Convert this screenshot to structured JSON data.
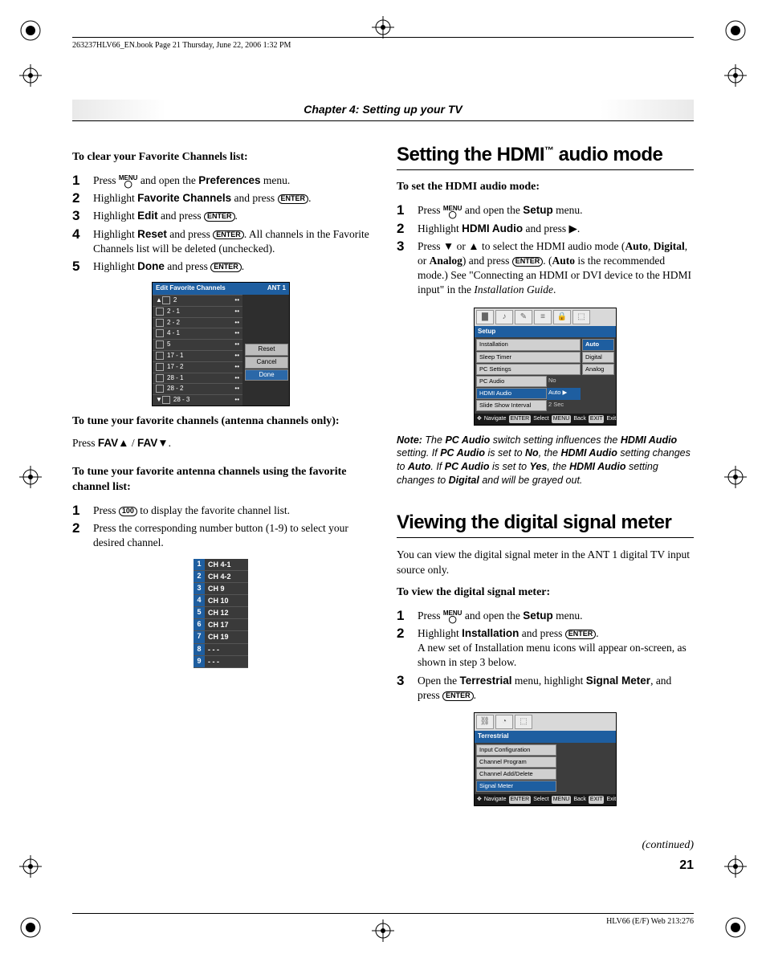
{
  "header": {
    "info": "263237HLV66_EN.book  Page 21  Thursday, June 22, 2006  1:32 PM"
  },
  "chapter": "Chapter 4: Setting up your TV",
  "left": {
    "h1": "To clear your Favorite Channels list:",
    "s1": {
      "a": "Press ",
      "b": " and open the ",
      "c": "Preferences",
      "d": " menu."
    },
    "s2": {
      "a": "Highlight ",
      "b": "Favorite Channels",
      "c": " and press "
    },
    "s3": {
      "a": "Highlight ",
      "b": "Edit",
      "c": " and press "
    },
    "s4": {
      "a": "Highlight ",
      "b": "Reset",
      "c": " and press ",
      "d": ". All channels in the Favorite Channels list will be deleted (unchecked)."
    },
    "s5": {
      "a": "Highlight ",
      "b": "Done",
      "c": " and press "
    },
    "osd1": {
      "title": "Edit Favorite Channels",
      "ant": "ANT 1",
      "rows": [
        "2",
        "2 - 1",
        "2 - 2",
        "4 - 1",
        "5",
        "17 - 1",
        "17 - 2",
        "28 - 1",
        "28 - 2",
        "28 - 3"
      ],
      "btns": [
        "Reset",
        "Cancel",
        "Done"
      ]
    },
    "h2": "To tune your favorite channels (antenna channels only):",
    "p2": {
      "a": "Press ",
      "b": "FAV▲",
      "c": " / ",
      "d": "FAV▼",
      "e": "."
    },
    "h3": "To tune your favorite antenna channels using the favorite channel list:",
    "s6": "Press  to display the favorite channel list.",
    "s6a": "Press ",
    "s6b": " to display the favorite channel list.",
    "s7": "Press the corresponding number button (1-9) to select your desired channel.",
    "favlist": [
      "CH 4-1",
      "CH 4-2",
      "CH 9",
      "CH 10",
      "CH 12",
      "CH 17",
      "CH 19",
      "- - -",
      "- - -"
    ]
  },
  "right": {
    "title1": "Setting the HDMI™ audio mode",
    "h1": "To set the HDMI audio mode:",
    "s1": {
      "a": "Press ",
      "b": " and open the ",
      "c": "Setup",
      "d": " menu."
    },
    "s2": {
      "a": "Highlight ",
      "b": "HDMI Audio",
      "c": " and press ▶."
    },
    "s3": {
      "a": "Press ▼ or ▲ to select the HDMI audio mode (",
      "b": "Auto",
      "c": ", ",
      "d": "Digital",
      "e": ", or ",
      "f": "Analog",
      "g": ") and press ",
      "h": ". (",
      "i": "Auto",
      "j": " is the recommended mode.) See \"Connecting an HDMI or DVI device to the HDMI input\" in the ",
      "k": "Installation Guide",
      "l": "."
    },
    "osd2": {
      "hdr": "Setup",
      "items": [
        "Installation",
        "Sleep Timer",
        "PC Settings",
        "PC Audio",
        "HDMI Audio",
        "Slide Show Interval"
      ],
      "vals": [
        "",
        "",
        "",
        "No",
        "Auto ▶",
        "2 Sec"
      ],
      "opts": [
        "Auto",
        "Digital",
        "Analog"
      ],
      "foot": {
        "nav": "Navigate",
        "sel": "Select",
        "back": "Back",
        "exit": "Exit",
        "k1": "ENTER",
        "k2": "MENU",
        "k3": "EXIT"
      }
    },
    "note": {
      "a": "Note:",
      "b": " The ",
      "c": "PC Audio",
      "d": " switch setting influences the ",
      "e": "HDMI Audio",
      "f": " setting. If ",
      "g": "PC Audio",
      "h": " is set to ",
      "i": "No",
      "j": ", the ",
      "k": "HDMI Audio",
      "l": " setting changes to ",
      "m": "Auto",
      "n": ". If ",
      "o": "PC Audio",
      "p": " is set to ",
      "q": "Yes",
      "r": ", the ",
      "s": "HDMI Audio",
      "t": " setting changes to ",
      "u": "Digital",
      "v": " and will be grayed out."
    },
    "title2": "Viewing the digital signal meter",
    "p1": "You can view the digital signal meter in the ANT 1 digital TV input source only.",
    "h2": "To view the digital signal meter:",
    "s4": {
      "a": "Press ",
      "b": " and open the ",
      "c": "Setup",
      "d": " menu."
    },
    "s5": {
      "a": "Highlight ",
      "b": "Installation",
      "c": " and press ",
      "d": ".",
      "e": "A new set of Installation menu icons will appear on-screen, as shown in step 3 below."
    },
    "s6": {
      "a": "Open the ",
      "b": "Terrestrial",
      "c": " menu, highlight ",
      "d": "Signal Meter",
      "e": ", and press "
    },
    "osd3": {
      "hdr": "Terrestrial",
      "items": [
        "Input Configuration",
        "Channel Program",
        "Channel Add/Delete",
        "Signal Meter"
      ],
      "foot": {
        "nav": "Navigate",
        "sel": "Select",
        "back": "Back",
        "exit": "Exit",
        "k1": "ENTER",
        "k2": "MENU",
        "k3": "EXIT"
      }
    }
  },
  "continued": "(continued)",
  "pagenum": "21",
  "footer": "HLV66 (E/F) Web 213:276"
}
